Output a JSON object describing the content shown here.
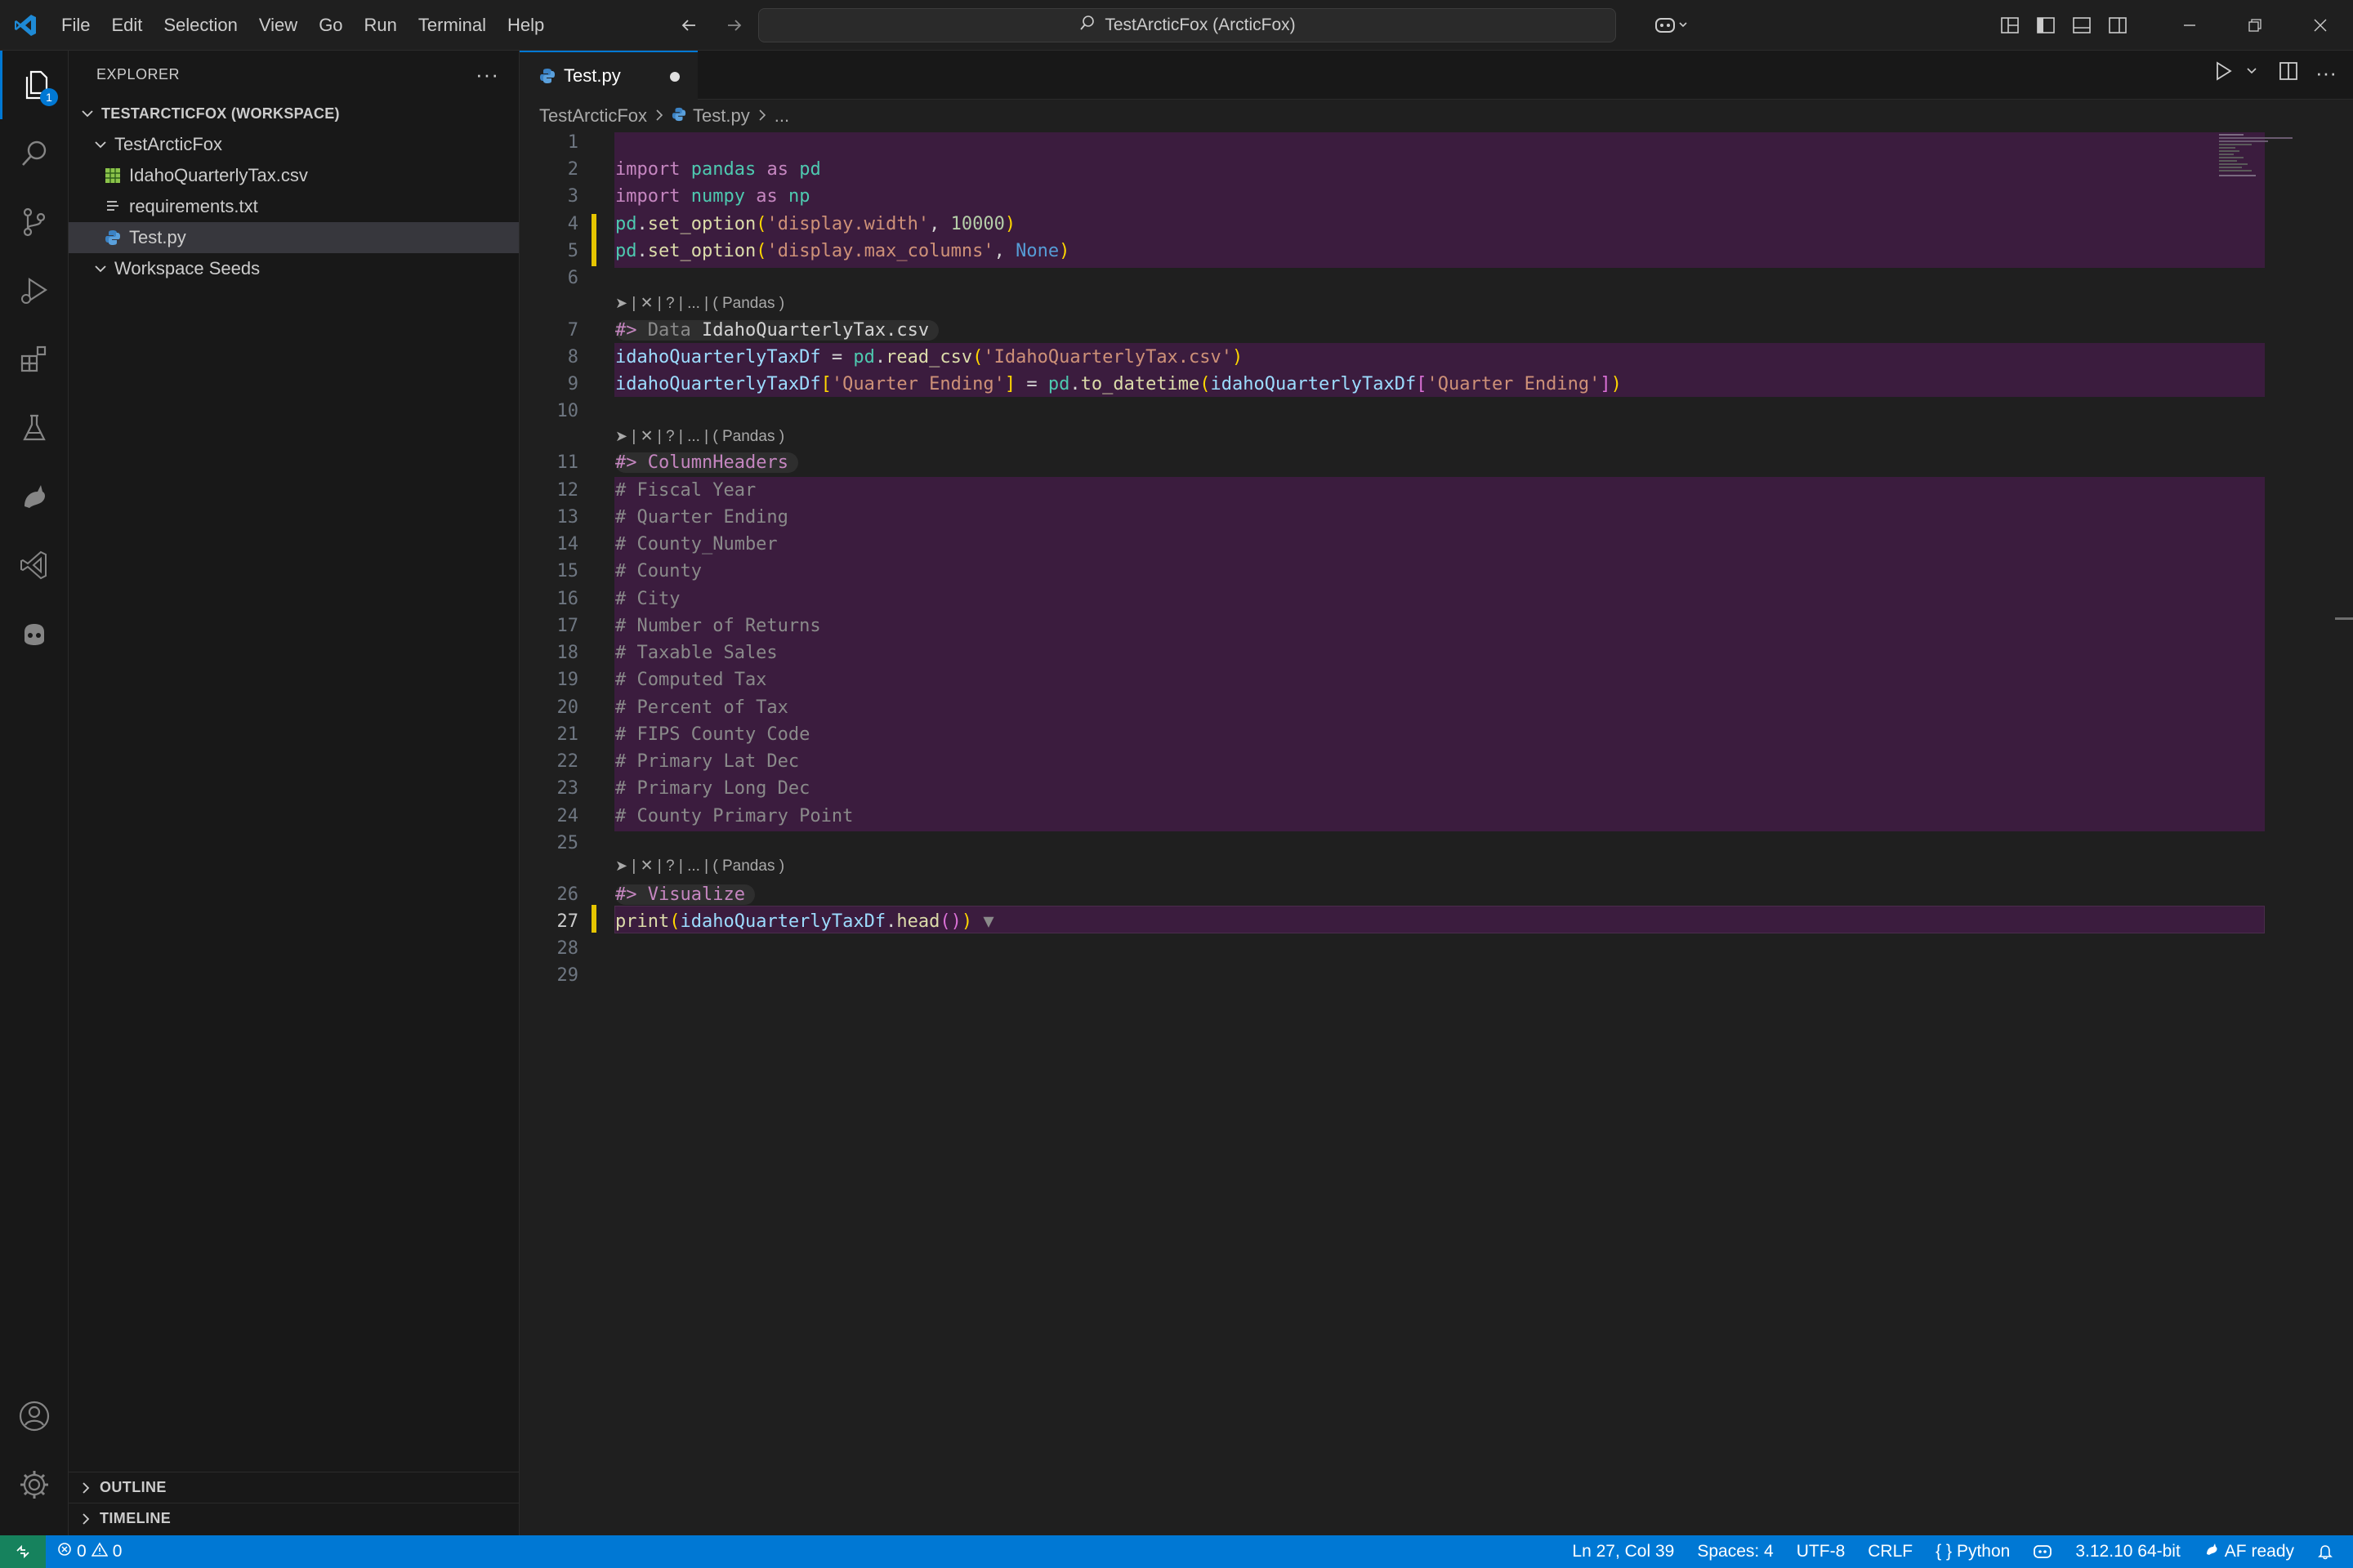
{
  "menu": [
    "File",
    "Edit",
    "Selection",
    "View",
    "Go",
    "Run",
    "Terminal",
    "Help"
  ],
  "command_center": {
    "text": "TestArcticFox (ArcticFox)"
  },
  "activity": {
    "explorer_badge": "1"
  },
  "sidebar": {
    "title": "EXPLORER",
    "workspace": "TESTARCTICFOX (WORKSPACE)",
    "folder": "TestArcticFox",
    "files": [
      "IdahoQuarterlyTax.csv",
      "requirements.txt",
      "Test.py"
    ],
    "seeds": "Workspace Seeds",
    "outline": "OUTLINE",
    "timeline": "TIMELINE"
  },
  "tab": {
    "label": "Test.py"
  },
  "breadcrumb": {
    "folder": "TestArcticFox",
    "file": "Test.py",
    "more": "..."
  },
  "line_numbers": [
    "1",
    "2",
    "3",
    "4",
    "5",
    "6",
    "7",
    "8",
    "9",
    "10",
    "11",
    "12",
    "13",
    "14",
    "15",
    "16",
    "17",
    "18",
    "19",
    "20",
    "21",
    "22",
    "23",
    "24",
    "25",
    "26",
    "27",
    "28",
    "29"
  ],
  "code_lens": {
    "controls": "| ✕ | ? | ... | ( Pandas )"
  },
  "code": {
    "l2": [
      "import",
      "pandas",
      "as",
      "pd"
    ],
    "l3": [
      "import",
      "numpy",
      "as",
      "np"
    ],
    "l4": {
      "obj": "pd",
      "fn": "set_option",
      "str": "'display.width'",
      "num": "10000"
    },
    "l5": {
      "obj": "pd",
      "fn": "set_option",
      "str": "'display.max_columns'",
      "kw": "None"
    },
    "l7": {
      "marker": "#>",
      "label": "Data",
      "name": "IdahoQuarterlyTax.csv"
    },
    "l8": {
      "var": "idahoQuarterlyTaxDf",
      "obj": "pd",
      "fn": "read_csv",
      "str": "'IdahoQuarterlyTax.csv'"
    },
    "l9": {
      "var": "idahoQuarterlyTaxDf",
      "key": "'Quarter Ending'",
      "obj": "pd",
      "fn": "to_datetime",
      "arg": "idahoQuarterlyTaxDf",
      "key2": "'Quarter Ending'"
    },
    "l11": {
      "marker": "#>",
      "label": "ColumnHeaders"
    },
    "comments": [
      "# Fiscal Year",
      "# Quarter Ending",
      "# County_Number",
      "# County",
      "# City",
      "# Number of Returns",
      "# Taxable Sales",
      "# Computed Tax",
      "# Percent of Tax",
      "# FIPS County Code",
      "# Primary Lat Dec",
      "# Primary Long Dec",
      "# County Primary Point"
    ],
    "l26": {
      "marker": "#>",
      "label": "Visualize"
    },
    "l27": {
      "fn": "print",
      "var": "idahoQuarterlyTaxDf",
      "method": "head",
      "fold": "▼"
    }
  },
  "statusbar": {
    "errors": "0",
    "warnings": "0",
    "position": "Ln 27, Col 39",
    "spaces": "Spaces: 4",
    "encoding": "UTF-8",
    "eol": "CRLF",
    "language": "Python",
    "interpreter": "3.12.10 64-bit",
    "extension": "AF ready"
  },
  "colors": {
    "accent": "#0078d4",
    "cell": "#3b1c3e",
    "modified": "#e6c500",
    "remote": "#16825d"
  }
}
